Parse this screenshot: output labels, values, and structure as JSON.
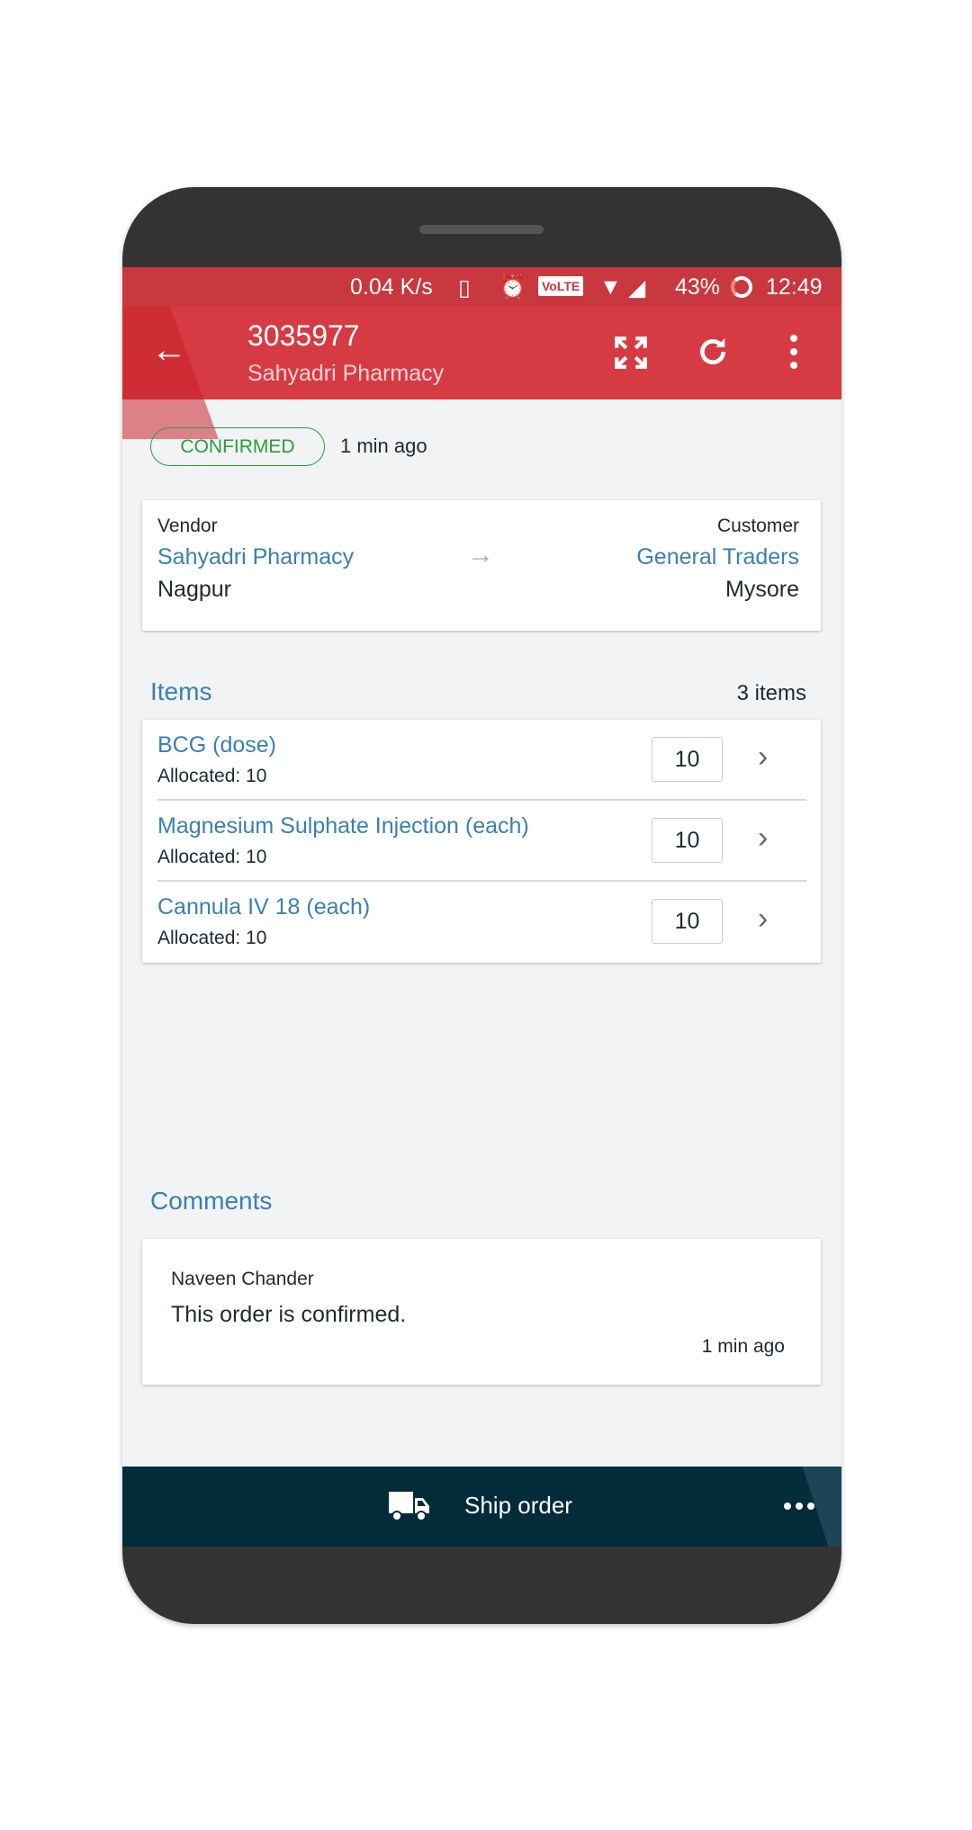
{
  "status_bar": {
    "speed": "0.04 K/s",
    "volte": "VoLTE",
    "battery": "43%",
    "time": "12:49"
  },
  "toolbar": {
    "title": "3035977",
    "subtitle": "Sahyadri Pharmacy"
  },
  "order": {
    "status": "CONFIRMED",
    "updated": "1 min ago"
  },
  "parties": {
    "vendor_label": "Vendor",
    "vendor_name": "Sahyadri Pharmacy",
    "vendor_city": "Nagpur",
    "customer_label": "Customer",
    "customer_name": "General Traders",
    "customer_city": "Mysore"
  },
  "items_section": {
    "title": "Items",
    "count": "3 items"
  },
  "items": [
    {
      "name": "BCG (dose)",
      "allocated": "Allocated: 10",
      "quantity": "10"
    },
    {
      "name": "Magnesium Sulphate Injection (each)",
      "allocated": "Allocated: 10",
      "quantity": "10"
    },
    {
      "name": "Cannula IV 18 (each)",
      "allocated": "Allocated: 10",
      "quantity": "10"
    }
  ],
  "comments_section": {
    "title": "Comments"
  },
  "comments": [
    {
      "author": "Naveen Chander",
      "text": "This order is confirmed.",
      "time": "1 min ago"
    }
  ],
  "bottom_bar": {
    "action": "Ship order"
  },
  "colors": {
    "toolbar": "#d63b44",
    "accent_blue": "#3a7fb4",
    "status_green": "#2a9d3a",
    "bottom_bar": "#032c3b"
  }
}
